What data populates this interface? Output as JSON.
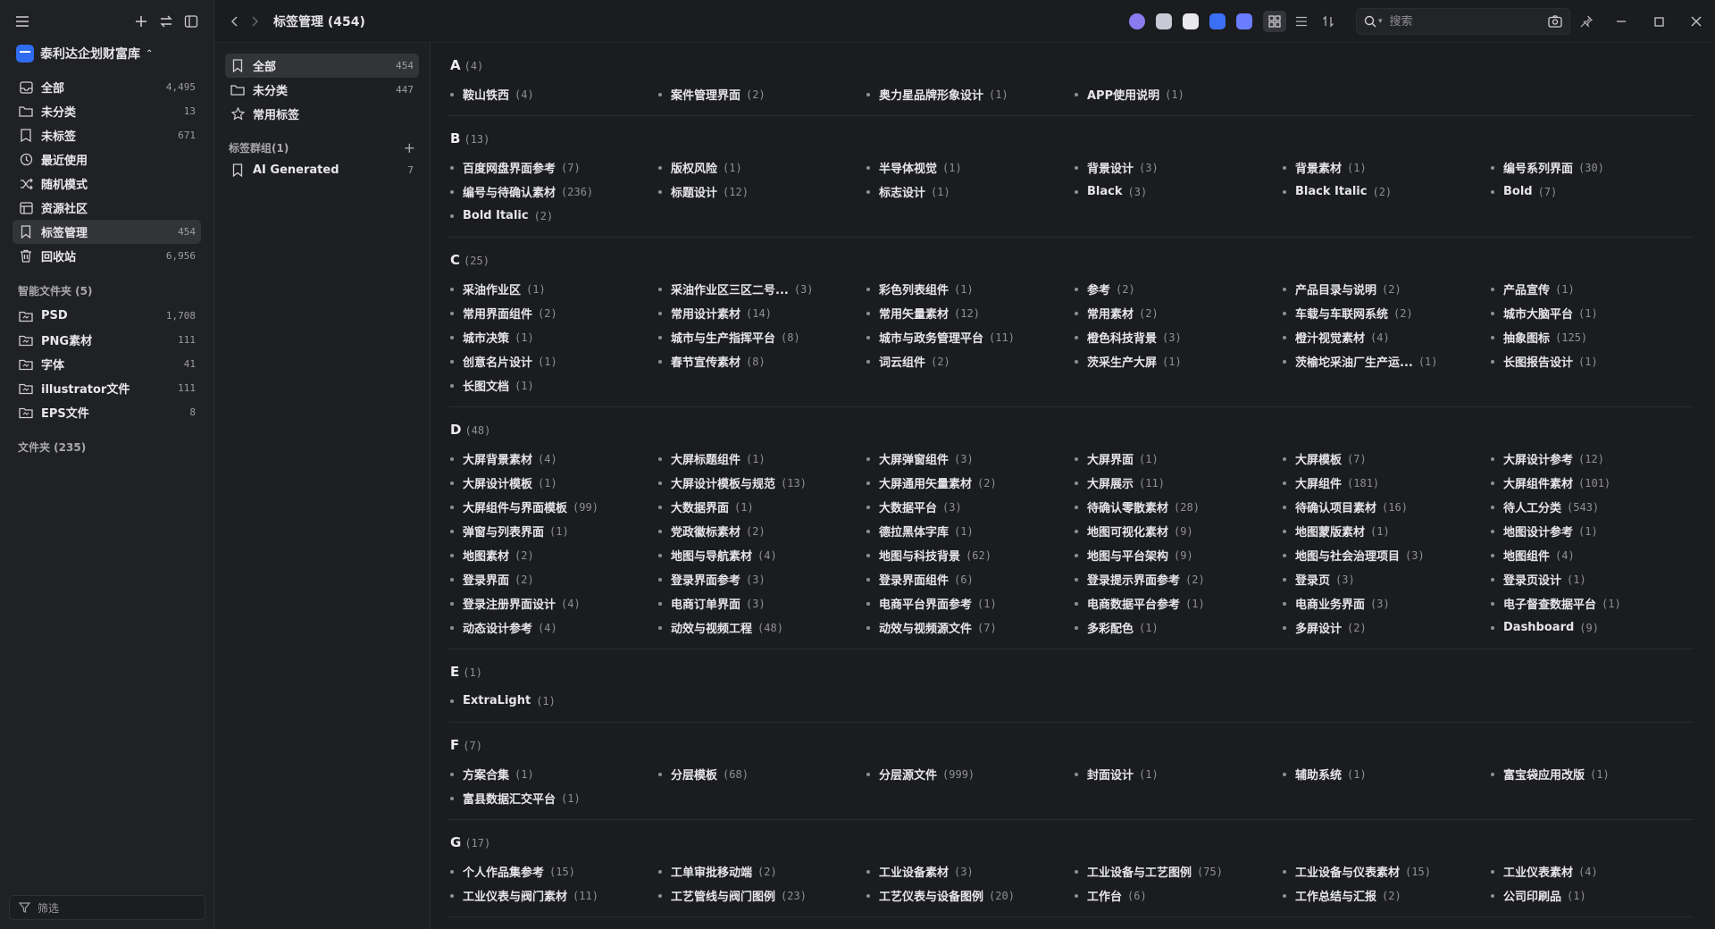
{
  "sidebar": {
    "library_name": "泰利达企划财富库",
    "items": [
      {
        "label": "全部",
        "count": "4,495",
        "icon": "inbox-icon"
      },
      {
        "label": "未分类",
        "count": "13",
        "icon": "folder-question-icon"
      },
      {
        "label": "未标签",
        "count": "671",
        "icon": "tag-off-icon"
      },
      {
        "label": "最近使用",
        "count": "",
        "icon": "clock-icon"
      },
      {
        "label": "随机模式",
        "count": "",
        "icon": "shuffle-icon"
      },
      {
        "label": "资源社区",
        "count": "",
        "icon": "community-icon"
      },
      {
        "label": "标签管理",
        "count": "454",
        "icon": "bookmark-icon"
      },
      {
        "label": "回收站",
        "count": "6,956",
        "icon": "trash-icon"
      }
    ],
    "smart_folders_label": "智能文件夹 (5)",
    "smart_folders": [
      {
        "label": "PSD",
        "count": "1,708"
      },
      {
        "label": "PNG素材",
        "count": "111"
      },
      {
        "label": "字体",
        "count": "41"
      },
      {
        "label": "illustrator文件",
        "count": "111"
      },
      {
        "label": "EPS文件",
        "count": "8"
      }
    ],
    "folders_label": "文件夹 (235)",
    "filter_label": "筛选"
  },
  "panel": {
    "items": [
      {
        "label": "全部",
        "count": "454",
        "icon": "bookmark-icon"
      },
      {
        "label": "未分类",
        "count": "447",
        "icon": "folder-question-icon"
      },
      {
        "label": "常用标签",
        "count": "",
        "icon": "star-icon"
      }
    ],
    "groups_label": "标签群组(1)",
    "groups": [
      {
        "label": "AI Generated",
        "count": "7",
        "icon": "bookmark-icon"
      }
    ]
  },
  "topbar": {
    "title": "标签管理 (454)",
    "search_placeholder": "搜索",
    "plugin_colors": [
      "#8a7cf0",
      "#c9c9d6",
      "#e8e8ee",
      "#3b6ff5",
      "#6a7cff"
    ]
  },
  "tag_groups": [
    {
      "letter": "A",
      "count": "(4)",
      "tags": [
        {
          "name": "鞍山铁西",
          "count": "(4)"
        },
        {
          "name": "案件管理界面",
          "count": "(2)"
        },
        {
          "name": "奥力星品牌形象设计",
          "count": "(1)"
        },
        {
          "name": "APP使用说明",
          "count": "(1)"
        }
      ]
    },
    {
      "letter": "B",
      "count": "(13)",
      "tags": [
        {
          "name": "百度网盘界面参考",
          "count": "(7)"
        },
        {
          "name": "版权风险",
          "count": "(1)"
        },
        {
          "name": "半导体视觉",
          "count": "(1)"
        },
        {
          "name": "背景设计",
          "count": "(3)"
        },
        {
          "name": "背景素材",
          "count": "(1)"
        },
        {
          "name": "编号系列界面",
          "count": "(30)"
        },
        {
          "name": "编号与待确认素材",
          "count": "(236)"
        },
        {
          "name": "标题设计",
          "count": "(12)"
        },
        {
          "name": "标志设计",
          "count": "(1)"
        },
        {
          "name": "Black",
          "count": "(3)"
        },
        {
          "name": "Black Italic",
          "count": "(2)"
        },
        {
          "name": "Bold",
          "count": "(7)"
        },
        {
          "name": "Bold Italic",
          "count": "(2)"
        }
      ]
    },
    {
      "letter": "C",
      "count": "(25)",
      "tags": [
        {
          "name": "采油作业区",
          "count": "(1)"
        },
        {
          "name": "采油作业区三区二号...",
          "count": "(3)"
        },
        {
          "name": "彩色列表组件",
          "count": "(1)"
        },
        {
          "name": "参考",
          "count": "(2)"
        },
        {
          "name": "产品目录与说明",
          "count": "(2)"
        },
        {
          "name": "产品宣传",
          "count": "(1)"
        },
        {
          "name": "常用界面组件",
          "count": "(2)"
        },
        {
          "name": "常用设计素材",
          "count": "(14)"
        },
        {
          "name": "常用矢量素材",
          "count": "(12)"
        },
        {
          "name": "常用素材",
          "count": "(2)"
        },
        {
          "name": "车载与车联网系统",
          "count": "(2)"
        },
        {
          "name": "城市大脑平台",
          "count": "(1)"
        },
        {
          "name": "城市决策",
          "count": "(1)"
        },
        {
          "name": "城市与生产指挥平台",
          "count": "(8)"
        },
        {
          "name": "城市与政务管理平台",
          "count": "(11)"
        },
        {
          "name": "橙色科技背景",
          "count": "(3)"
        },
        {
          "name": "橙汁视觉素材",
          "count": "(4)"
        },
        {
          "name": "抽象图标",
          "count": "(125)"
        },
        {
          "name": "创意名片设计",
          "count": "(1)"
        },
        {
          "name": "春节宣传素材",
          "count": "(8)"
        },
        {
          "name": "词云组件",
          "count": "(2)"
        },
        {
          "name": "茨采生产大屏",
          "count": "(1)"
        },
        {
          "name": "茨榆坨采油厂生产运...",
          "count": "(1)"
        },
        {
          "name": "长图报告设计",
          "count": "(1)"
        },
        {
          "name": "长图文档",
          "count": "(1)"
        }
      ]
    },
    {
      "letter": "D",
      "count": "(48)",
      "tags": [
        {
          "name": "大屏背景素材",
          "count": "(4)"
        },
        {
          "name": "大屏标题组件",
          "count": "(1)"
        },
        {
          "name": "大屏弹窗组件",
          "count": "(3)"
        },
        {
          "name": "大屏界面",
          "count": "(1)"
        },
        {
          "name": "大屏模板",
          "count": "(7)"
        },
        {
          "name": "大屏设计参考",
          "count": "(12)"
        },
        {
          "name": "大屏设计模板",
          "count": "(1)"
        },
        {
          "name": "大屏设计模板与规范",
          "count": "(13)"
        },
        {
          "name": "大屏通用矢量素材",
          "count": "(2)"
        },
        {
          "name": "大屏展示",
          "count": "(11)"
        },
        {
          "name": "大屏组件",
          "count": "(181)"
        },
        {
          "name": "大屏组件素材",
          "count": "(101)"
        },
        {
          "name": "大屏组件与界面模板",
          "count": "(99)"
        },
        {
          "name": "大数据界面",
          "count": "(1)"
        },
        {
          "name": "大数据平台",
          "count": "(3)"
        },
        {
          "name": "待确认零散素材",
          "count": "(28)"
        },
        {
          "name": "待确认项目素材",
          "count": "(16)"
        },
        {
          "name": "待人工分类",
          "count": "(543)"
        },
        {
          "name": "弹窗与列表界面",
          "count": "(1)"
        },
        {
          "name": "党政徽标素材",
          "count": "(2)"
        },
        {
          "name": "德拉黑体字库",
          "count": "(1)"
        },
        {
          "name": "地图可视化素材",
          "count": "(9)"
        },
        {
          "name": "地图蒙版素材",
          "count": "(1)"
        },
        {
          "name": "地图设计参考",
          "count": "(1)"
        },
        {
          "name": "地图素材",
          "count": "(2)"
        },
        {
          "name": "地图与导航素材",
          "count": "(4)"
        },
        {
          "name": "地图与科技背景",
          "count": "(62)"
        },
        {
          "name": "地图与平台架构",
          "count": "(9)"
        },
        {
          "name": "地图与社会治理项目",
          "count": "(3)"
        },
        {
          "name": "地图组件",
          "count": "(4)"
        },
        {
          "name": "登录界面",
          "count": "(2)"
        },
        {
          "name": "登录界面参考",
          "count": "(3)"
        },
        {
          "name": "登录界面组件",
          "count": "(6)"
        },
        {
          "name": "登录提示界面参考",
          "count": "(2)"
        },
        {
          "name": "登录页",
          "count": "(3)"
        },
        {
          "name": "登录页设计",
          "count": "(1)"
        },
        {
          "name": "登录注册界面设计",
          "count": "(4)"
        },
        {
          "name": "电商订单界面",
          "count": "(3)"
        },
        {
          "name": "电商平台界面参考",
          "count": "(1)"
        },
        {
          "name": "电商数据平台参考",
          "count": "(1)"
        },
        {
          "name": "电商业务界面",
          "count": "(3)"
        },
        {
          "name": "电子督查数据平台",
          "count": "(1)"
        },
        {
          "name": "动态设计参考",
          "count": "(4)"
        },
        {
          "name": "动效与视频工程",
          "count": "(48)"
        },
        {
          "name": "动效与视频源文件",
          "count": "(7)"
        },
        {
          "name": "多彩配色",
          "count": "(1)"
        },
        {
          "name": "多屏设计",
          "count": "(2)"
        },
        {
          "name": "Dashboard",
          "count": "(9)"
        }
      ]
    },
    {
      "letter": "E",
      "count": "(1)",
      "tags": [
        {
          "name": "ExtraLight",
          "count": "(1)"
        }
      ]
    },
    {
      "letter": "F",
      "count": "(7)",
      "tags": [
        {
          "name": "方案合集",
          "count": "(1)"
        },
        {
          "name": "分层模板",
          "count": "(68)"
        },
        {
          "name": "分层源文件",
          "count": "(999)"
        },
        {
          "name": "封面设计",
          "count": "(1)"
        },
        {
          "name": "辅助系统",
          "count": "(1)"
        },
        {
          "name": "富宝袋应用改版",
          "count": "(1)"
        },
        {
          "name": "富县数据汇交平台",
          "count": "(1)"
        }
      ]
    },
    {
      "letter": "G",
      "count": "(17)",
      "tags": [
        {
          "name": "个人作品集参考",
          "count": "(15)"
        },
        {
          "name": "工单审批移动端",
          "count": "(2)"
        },
        {
          "name": "工业设备素材",
          "count": "(3)"
        },
        {
          "name": "工业设备与工艺图例",
          "count": "(75)"
        },
        {
          "name": "工业设备与仪表素材",
          "count": "(15)"
        },
        {
          "name": "工业仪表素材",
          "count": "(4)"
        },
        {
          "name": "工业仪表与阀门素材",
          "count": "(11)"
        },
        {
          "name": "工艺管线与阀门图例",
          "count": "(23)"
        },
        {
          "name": "工艺仪表与设备图例",
          "count": "(20)"
        },
        {
          "name": "工作台",
          "count": "(6)"
        },
        {
          "name": "工作总结与汇报",
          "count": "(2)"
        },
        {
          "name": "公司印刷品",
          "count": "(1)"
        }
      ]
    }
  ]
}
